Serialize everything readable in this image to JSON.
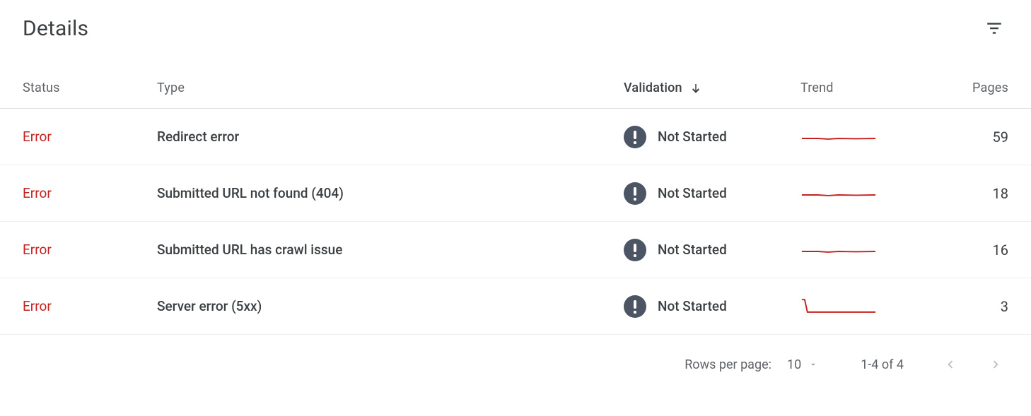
{
  "header": {
    "title": "Details"
  },
  "columns": {
    "status": "Status",
    "type": "Type",
    "validation": "Validation",
    "trend": "Trend",
    "pages": "Pages"
  },
  "sort": {
    "column": "validation",
    "direction": "desc"
  },
  "rows": [
    {
      "status": "Error",
      "type": "Redirect error",
      "validation": "Not Started",
      "pages": "59",
      "spark": "flat"
    },
    {
      "status": "Error",
      "type": "Submitted URL not found (404)",
      "validation": "Not Started",
      "pages": "18",
      "spark": "flat"
    },
    {
      "status": "Error",
      "type": "Submitted URL has crawl issue",
      "validation": "Not Started",
      "pages": "16",
      "spark": "flat"
    },
    {
      "status": "Error",
      "type": "Server error (5xx)",
      "validation": "Not Started",
      "pages": "3",
      "spark": "drop"
    }
  ],
  "pagination": {
    "rows_per_page_label": "Rows per page:",
    "rows_per_page_value": "10",
    "range_label": "1-4 of 4"
  }
}
